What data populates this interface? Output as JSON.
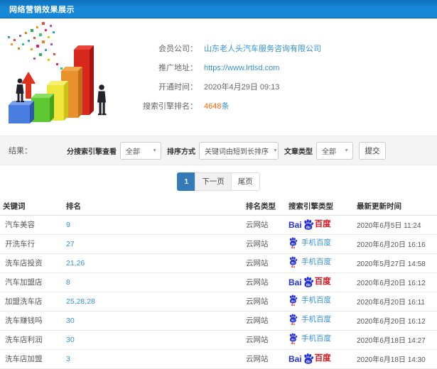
{
  "header": {
    "title": "网络营销效果展示"
  },
  "info": {
    "rows": [
      {
        "label": "会员公司：",
        "value": "山东老人头汽车服务咨询有限公司",
        "style": "link"
      },
      {
        "label": "推广地址：",
        "value": "https://www.lrtlsd.com",
        "style": "link"
      },
      {
        "label": "开通时间：",
        "value": "2020年4月29日 09:13",
        "style": "text"
      },
      {
        "label": "搜索引擎排名：",
        "value": "4648",
        "suffix": "条",
        "style": "rank"
      }
    ]
  },
  "filters": {
    "result_label": "结果：",
    "groups": [
      {
        "label": "分搜索引擎查看",
        "value": "全部",
        "name": "engine-filter",
        "cls": "sel-engine"
      },
      {
        "label": "排序方式",
        "value": "关键词由短到长排序",
        "name": "sort-order",
        "cls": "sel-sort"
      },
      {
        "label": "文章类型",
        "value": "全部",
        "name": "article-type",
        "cls": "sel-article"
      }
    ],
    "submit_label": "提交"
  },
  "pagination": {
    "items": [
      {
        "label": "1",
        "active": true
      },
      {
        "label": "下一页",
        "active": false
      },
      {
        "label": "尾页",
        "active": false
      }
    ]
  },
  "table": {
    "headers": [
      "关键词",
      "排名",
      "排名类型",
      "搜索引擎类型",
      "最新更新时间"
    ],
    "rows": [
      {
        "keyword": "汽车美容",
        "rank": "9",
        "rank_type": "云网站",
        "engine": "baidu",
        "updated": "2020年6月5日 11:24"
      },
      {
        "keyword": "开洗车行",
        "rank": "27",
        "rank_type": "云网站",
        "engine": "mobile-baidu",
        "updated": "2020年6月20日 16:16"
      },
      {
        "keyword": "洗车店投资",
        "rank": "21,26",
        "rank_type": "云网站",
        "engine": "mobile-baidu",
        "updated": "2020年5月27日 14:58"
      },
      {
        "keyword": "汽车加盟店",
        "rank": "8",
        "rank_type": "云网站",
        "engine": "baidu",
        "updated": "2020年6月20日 16:12"
      },
      {
        "keyword": "加盟洗车店",
        "rank": "25,28,28",
        "rank_type": "云网站",
        "engine": "mobile-baidu",
        "updated": "2020年6月20日 16:11"
      },
      {
        "keyword": "洗车赚钱吗",
        "rank": "30",
        "rank_type": "云网站",
        "engine": "mobile-baidu",
        "updated": "2020年6月20日 16:12"
      },
      {
        "keyword": "洗车店利润",
        "rank": "30",
        "rank_type": "云网站",
        "engine": "mobile-baidu",
        "updated": "2020年6月18日 14:27"
      },
      {
        "keyword": "洗车店加盟",
        "rank": "3",
        "rank_type": "云网站",
        "engine": "baidu",
        "updated": "2020年6月18日 14:30"
      }
    ]
  },
  "brand": {
    "bai": "Bai",
    "du": "du",
    "cn": "百度",
    "mobile_label": "手机百度"
  },
  "icons": {
    "dropdown_caret": "▼",
    "paw": "baidu-paw-icon"
  },
  "colors": {
    "header_blue": "#1787d8",
    "link_blue": "#3492d2",
    "rank_orange": "#ff6600",
    "active_page_blue": "#337ab7",
    "baidu_blue": "#2633d9",
    "baidu_red": "#d7131c"
  }
}
